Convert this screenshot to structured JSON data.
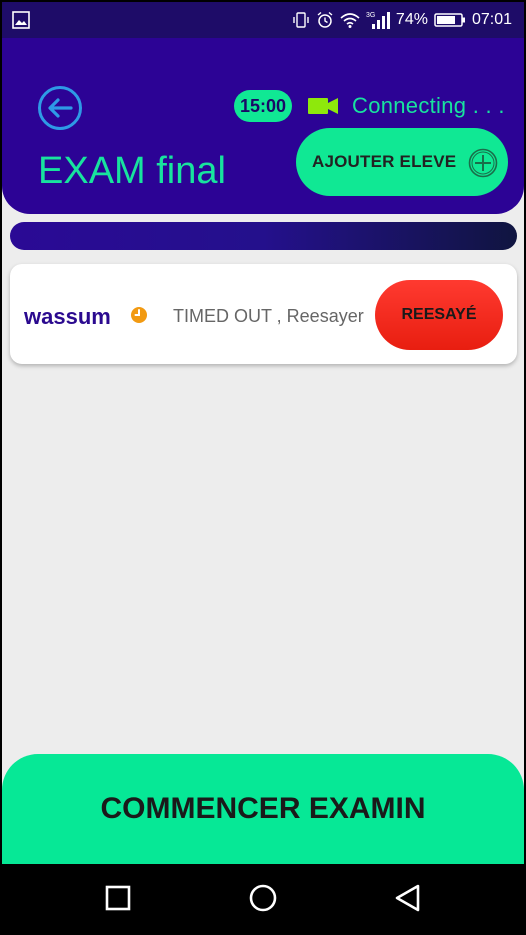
{
  "status_bar": {
    "battery_percent": "74%",
    "time": "07:01",
    "network_label": "3G",
    "icons": [
      "image-icon",
      "vibrate-icon",
      "alarm-icon",
      "wifi-icon",
      "signal-icon",
      "battery-icon"
    ]
  },
  "header": {
    "timer": "15:00",
    "connection_status": "Connecting . . .",
    "title": "EXAM final",
    "add_student_label": "AJOUTER ELEVE"
  },
  "progress": {
    "value": 0
  },
  "students": [
    {
      "name": "wassum",
      "status": "TIMED OUT , Reesayer",
      "retry_label": "REESAYÉ"
    }
  ],
  "footer": {
    "start_label": "COMMENCER EXAMIN"
  },
  "colors": {
    "header_bg": "#2c0395",
    "accent_green": "#10e894",
    "retry_red": "#f0281a",
    "name_purple": "#2b0a8f",
    "background": "#ededed"
  }
}
